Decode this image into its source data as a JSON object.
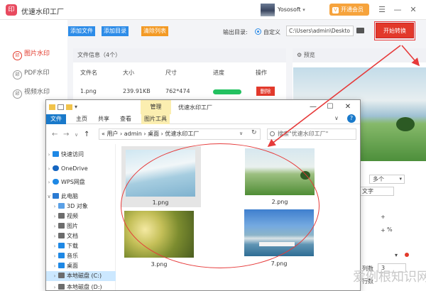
{
  "app": {
    "title": "优速水印工厂",
    "logo_glyph": "印",
    "user_name": "Yososoft",
    "user_chevron": "▾",
    "vip_label": "开通会员",
    "vip_icon_glyph": "V",
    "win_menu": "☰",
    "win_min": "—",
    "win_close": "✕"
  },
  "nav": {
    "items": [
      {
        "label": "图片水印",
        "icon": "印",
        "active": true
      },
      {
        "label": "PDF水印",
        "icon": "印",
        "active": false
      },
      {
        "label": "视频水印",
        "icon": "印",
        "active": false
      }
    ]
  },
  "toolbar": {
    "add_file": "添加文件",
    "add_dir": "添加目录",
    "clear_list": "清除列表",
    "outdir_label": "输出目录:",
    "outdir_option": "自定义",
    "outdir_path": "C:\\Users\\admin\\Deskto",
    "start_button": "开始转换"
  },
  "file_panel": {
    "header": "文件信息（4个）",
    "columns": [
      "文件名",
      "大小",
      "尺寸",
      "进度",
      "操作"
    ],
    "rows": [
      {
        "name": "1.png",
        "size": "239.91KB",
        "dimensions": "762*474",
        "progress": 1.0,
        "action": "删除"
      }
    ]
  },
  "preview": {
    "header": "预览",
    "header_icon": "⚙"
  },
  "settings": {
    "dropdown_value": "多个",
    "dropdown_chevron": "▾",
    "text_label": "文字",
    "plus_1": "+",
    "plus_2": "+",
    "percent": "%",
    "chevron": "▾",
    "columns_label": "列数",
    "columns_value": "3",
    "rows_label": "行数"
  },
  "explorer": {
    "title": "优速水印工厂",
    "qat_chevron": "▾",
    "manage_tab": "管理",
    "win_min": "—",
    "win_max": "☐",
    "win_close": "✕",
    "ribbon": {
      "file": "文件",
      "home": "主页",
      "share": "共享",
      "view": "查看",
      "picture_tools": "图片工具",
      "expand": "∨",
      "help": "?"
    },
    "nav": {
      "back": "←",
      "forward": "→",
      "recent": "∨",
      "up": "↑"
    },
    "address": "« 用户 › admin › 桌面 › 优速水印工厂",
    "address_dropdown": "∨",
    "address_refresh": "↻",
    "search_placeholder": "搜索\"优速水印工厂\"",
    "tree": [
      {
        "label": "快速访问",
        "chevron": "›",
        "icon_color": "#1e88e5"
      },
      {
        "label": "OneDrive",
        "chevron": "›",
        "icon_color": "#1565c0"
      },
      {
        "label": "WPS网盘",
        "chevron": "›",
        "icon_color": "#1e88e5"
      },
      {
        "label": "此电脑",
        "chevron": "∨",
        "icon_color": "#2b7bd3"
      },
      {
        "label": "3D 对象",
        "chevron": "›",
        "icon_color": "#5aa0e6"
      },
      {
        "label": "视频",
        "chevron": "›",
        "icon_color": "#6c6c6c"
      },
      {
        "label": "图片",
        "chevron": "›",
        "icon_color": "#6c6c6c"
      },
      {
        "label": "文档",
        "chevron": "›",
        "icon_color": "#6c6c6c"
      },
      {
        "label": "下载",
        "chevron": "›",
        "icon_color": "#1e88e5"
      },
      {
        "label": "音乐",
        "chevron": "›",
        "icon_color": "#1e88e5"
      },
      {
        "label": "桌面",
        "chevron": "›",
        "icon_color": "#1e88e5"
      },
      {
        "label": "本地磁盘 (C:)",
        "chevron": "›",
        "icon_color": "#6c6c6c"
      },
      {
        "label": "本地磁盘 (D:)",
        "chevron": "›",
        "icon_color": "#6c6c6c"
      }
    ],
    "files": [
      "1.png",
      "2.png",
      "3.png",
      "7.png"
    ]
  },
  "watermark_text": "爱例根知识网",
  "colors": {
    "accent_red": "#e2392b",
    "accent_blue": "#2d8ce8",
    "accent_orange": "#f39a25",
    "annotation": "#e63a3a"
  }
}
